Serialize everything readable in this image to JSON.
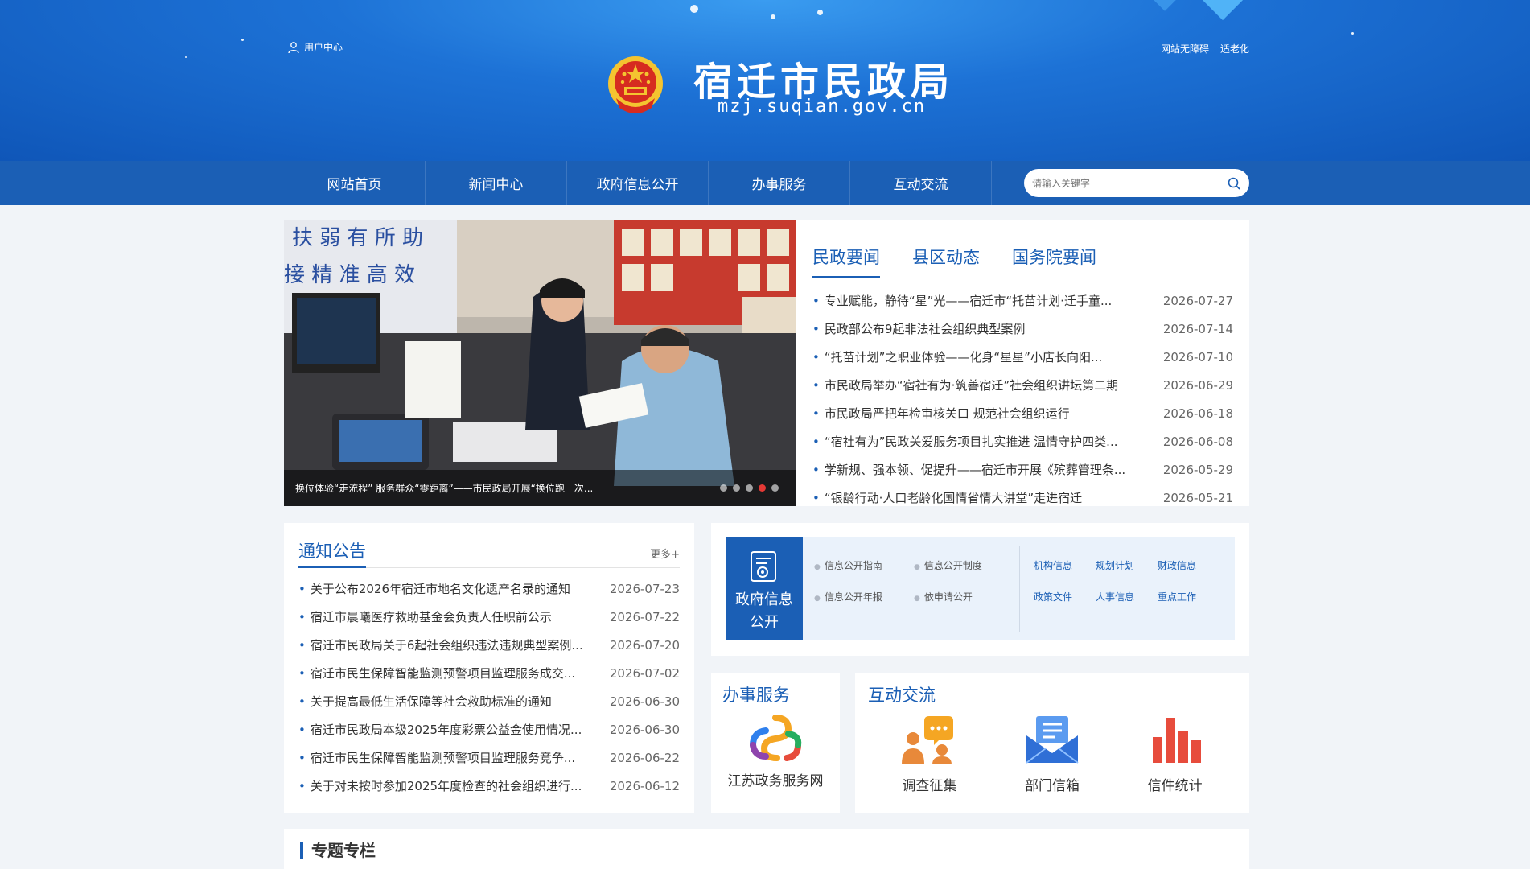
{
  "header": {
    "user_center": "用户中心",
    "accessibility": "网站无障碍",
    "elder_mode": "适老化",
    "site_title": "宿迁市民政局",
    "site_domain": "mzj.suqian.gov.cn"
  },
  "nav": {
    "items": [
      "网站首页",
      "新闻中心",
      "政府信息公开",
      "办事服务",
      "互动交流"
    ],
    "search_placeholder": "请输入关键字"
  },
  "carousel": {
    "caption": "换位体验“走流程” 服务群众“零距离”——市民政局开展“换位跑一次...",
    "banner_text_1": "扶 弱 有 所 助",
    "banner_text_2": "接  精 准 高 效",
    "dot_count": 5,
    "active_index": 3
  },
  "news": {
    "tabs": [
      "民政要闻",
      "县区动态",
      "国务院要闻"
    ],
    "items": [
      {
        "title": "专业赋能，静待“星”光——宿迁市“托苗计划·迁手童...",
        "date": "2026-07-27"
      },
      {
        "title": "民政部公布9起非法社会组织典型案例",
        "date": "2026-07-14"
      },
      {
        "title": "“托苗计划”之职业体验——化身“星星”小店长向阳...",
        "date": "2026-07-10"
      },
      {
        "title": "市民政局举办“宿社有为·筑善宿迁”社会组织讲坛第二期",
        "date": "2026-06-29"
      },
      {
        "title": "市民政局严把年检审核关口 规范社会组织运行",
        "date": "2026-06-18"
      },
      {
        "title": "“宿社有为”民政关爱服务项目扎实推进 温情守护四类...",
        "date": "2026-06-08"
      },
      {
        "title": "学新规、强本领、促提升——宿迁市开展《殡葬管理条...",
        "date": "2026-05-29"
      },
      {
        "title": "“银龄行动·人口老龄化国情省情大讲堂”走进宿迁",
        "date": "2026-05-21"
      }
    ]
  },
  "notices": {
    "title": "通知公告",
    "more": "更多+",
    "items": [
      {
        "title": "关于公布2026年宿迁市地名文化遗产名录的通知",
        "date": "2026-07-23"
      },
      {
        "title": "宿迁市晨曦医疗救助基金会负责人任职前公示",
        "date": "2026-07-22"
      },
      {
        "title": "宿迁市民政局关于6起社会组织违法违规典型案例...",
        "date": "2026-07-20"
      },
      {
        "title": "宿迁市民生保障智能监测预警项目监理服务成交...",
        "date": "2026-07-02"
      },
      {
        "title": "关于提高最低生活保障等社会救助标准的通知",
        "date": "2026-06-30"
      },
      {
        "title": "宿迁市民政局本级2025年度彩票公益金使用情况...",
        "date": "2026-06-30"
      },
      {
        "title": "宿迁市民生保障智能监测预警项目监理服务竞争...",
        "date": "2026-06-22"
      },
      {
        "title": "关于对未按时参加2025年度检查的社会组织进行...",
        "date": "2026-06-12"
      }
    ]
  },
  "gov_info": {
    "tile_line1": "政府信息",
    "tile_line2": "公开",
    "links_a": [
      "信息公开指南",
      "信息公开制度",
      "信息公开年报",
      "依申请公开"
    ],
    "links_b": [
      "机构信息",
      "规划计划",
      "财政信息",
      "政策文件",
      "人事信息",
      "重点工作"
    ]
  },
  "service": {
    "title": "办事服务",
    "item_label": "江苏政务服务网"
  },
  "interact": {
    "title": "互动交流",
    "items": [
      "调查征集",
      "部门信箱",
      "信件统计"
    ]
  },
  "special": {
    "title": "专题专栏"
  },
  "colors": {
    "primary": "#1b5fb5",
    "header_light": "#3a9cf0",
    "accent_red": "#e53935"
  }
}
